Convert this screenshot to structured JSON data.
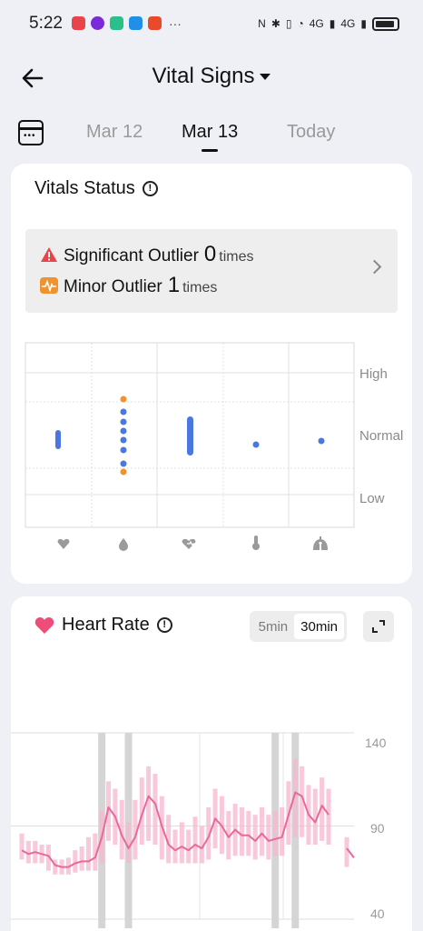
{
  "status_bar": {
    "time": "5:22",
    "network_labels": [
      "4G",
      "4G"
    ]
  },
  "header": {
    "title": "Vital Signs"
  },
  "dates": {
    "tabs": [
      "Mar 12",
      "Mar 13",
      "Today"
    ],
    "active_index": 1
  },
  "vitals_status": {
    "title": "Vitals Status",
    "significant": {
      "label": "Significant Outlier",
      "count": "0",
      "unit": "times"
    },
    "minor": {
      "label": "Minor Outlier",
      "count": "1",
      "unit": "times"
    },
    "levels": [
      "High",
      "Normal",
      "Low"
    ],
    "categories": [
      "heart-rate",
      "blood-oxygen",
      "hrv",
      "temperature",
      "respiration"
    ],
    "colors": {
      "normal": "#4a78e0",
      "outlier": "#f0922e",
      "significant": "#e8454a"
    }
  },
  "heart_rate": {
    "title": "Heart Rate",
    "intervals": [
      "5min",
      "30min"
    ],
    "active_interval": "30min",
    "y_ticks": [
      "140",
      "90",
      "40"
    ],
    "colors": {
      "line": "#e8699a",
      "band": "#f7b6cd",
      "gap": "#d5d5d5",
      "heart": "#ee4d7a"
    }
  },
  "chart_data": {
    "type": "line",
    "title": "Heart Rate",
    "ylim": [
      40,
      140
    ],
    "yticks": [
      140,
      90,
      40
    ],
    "grid": true,
    "series": [
      {
        "name": "Heart Rate",
        "values": [
          77,
          75,
          76,
          75,
          74,
          69,
          68,
          68,
          70,
          71,
          71,
          73,
          84,
          100,
          95,
          85,
          78,
          84,
          96,
          106,
          102,
          90,
          80,
          77,
          79,
          77,
          80,
          78,
          84,
          94,
          90,
          84,
          88,
          85,
          85,
          82,
          86,
          82,
          83,
          84,
          96,
          108,
          106,
          96,
          92,
          101,
          96
        ]
      }
    ],
    "bands": [
      {
        "low": 72,
        "high": 86
      },
      {
        "low": 70,
        "high": 82
      },
      {
        "low": 70,
        "high": 82
      },
      {
        "low": 70,
        "high": 80
      },
      {
        "low": 66,
        "high": 80
      },
      {
        "low": 64,
        "high": 72
      },
      {
        "low": 64,
        "high": 72
      },
      {
        "low": 64,
        "high": 73
      },
      {
        "low": 65,
        "high": 77
      },
      {
        "low": 66,
        "high": 79
      },
      {
        "low": 66,
        "high": 84
      },
      {
        "low": 66,
        "high": 86
      },
      {
        "low": 70,
        "high": 98
      },
      {
        "low": 82,
        "high": 114
      },
      {
        "low": 80,
        "high": 110
      },
      {
        "low": 72,
        "high": 104
      },
      {
        "low": 70,
        "high": 92
      },
      {
        "low": 72,
        "high": 104
      },
      {
        "low": 80,
        "high": 116
      },
      {
        "low": 82,
        "high": 122
      },
      {
        "low": 80,
        "high": 118
      },
      {
        "low": 72,
        "high": 106
      },
      {
        "low": 70,
        "high": 96
      },
      {
        "low": 70,
        "high": 88
      },
      {
        "low": 70,
        "high": 92
      },
      {
        "low": 70,
        "high": 88
      },
      {
        "low": 70,
        "high": 95
      },
      {
        "low": 70,
        "high": 90
      },
      {
        "low": 72,
        "high": 100
      },
      {
        "low": 78,
        "high": 110
      },
      {
        "low": 75,
        "high": 106
      },
      {
        "low": 72,
        "high": 98
      },
      {
        "low": 74,
        "high": 102
      },
      {
        "low": 74,
        "high": 100
      },
      {
        "low": 74,
        "high": 98
      },
      {
        "low": 72,
        "high": 96
      },
      {
        "low": 74,
        "high": 100
      },
      {
        "low": 72,
        "high": 96
      },
      {
        "low": 74,
        "high": 98
      },
      {
        "low": 74,
        "high": 100
      },
      {
        "low": 80,
        "high": 114
      },
      {
        "low": 84,
        "high": 126
      },
      {
        "low": 84,
        "high": 122
      },
      {
        "low": 80,
        "high": 112
      },
      {
        "low": 80,
        "high": 110
      },
      {
        "low": 82,
        "high": 116
      },
      {
        "low": 80,
        "high": 110
      }
    ],
    "tail_values": [
      78,
      73
    ],
    "gap_columns": [
      12,
      16,
      38,
      41
    ]
  }
}
